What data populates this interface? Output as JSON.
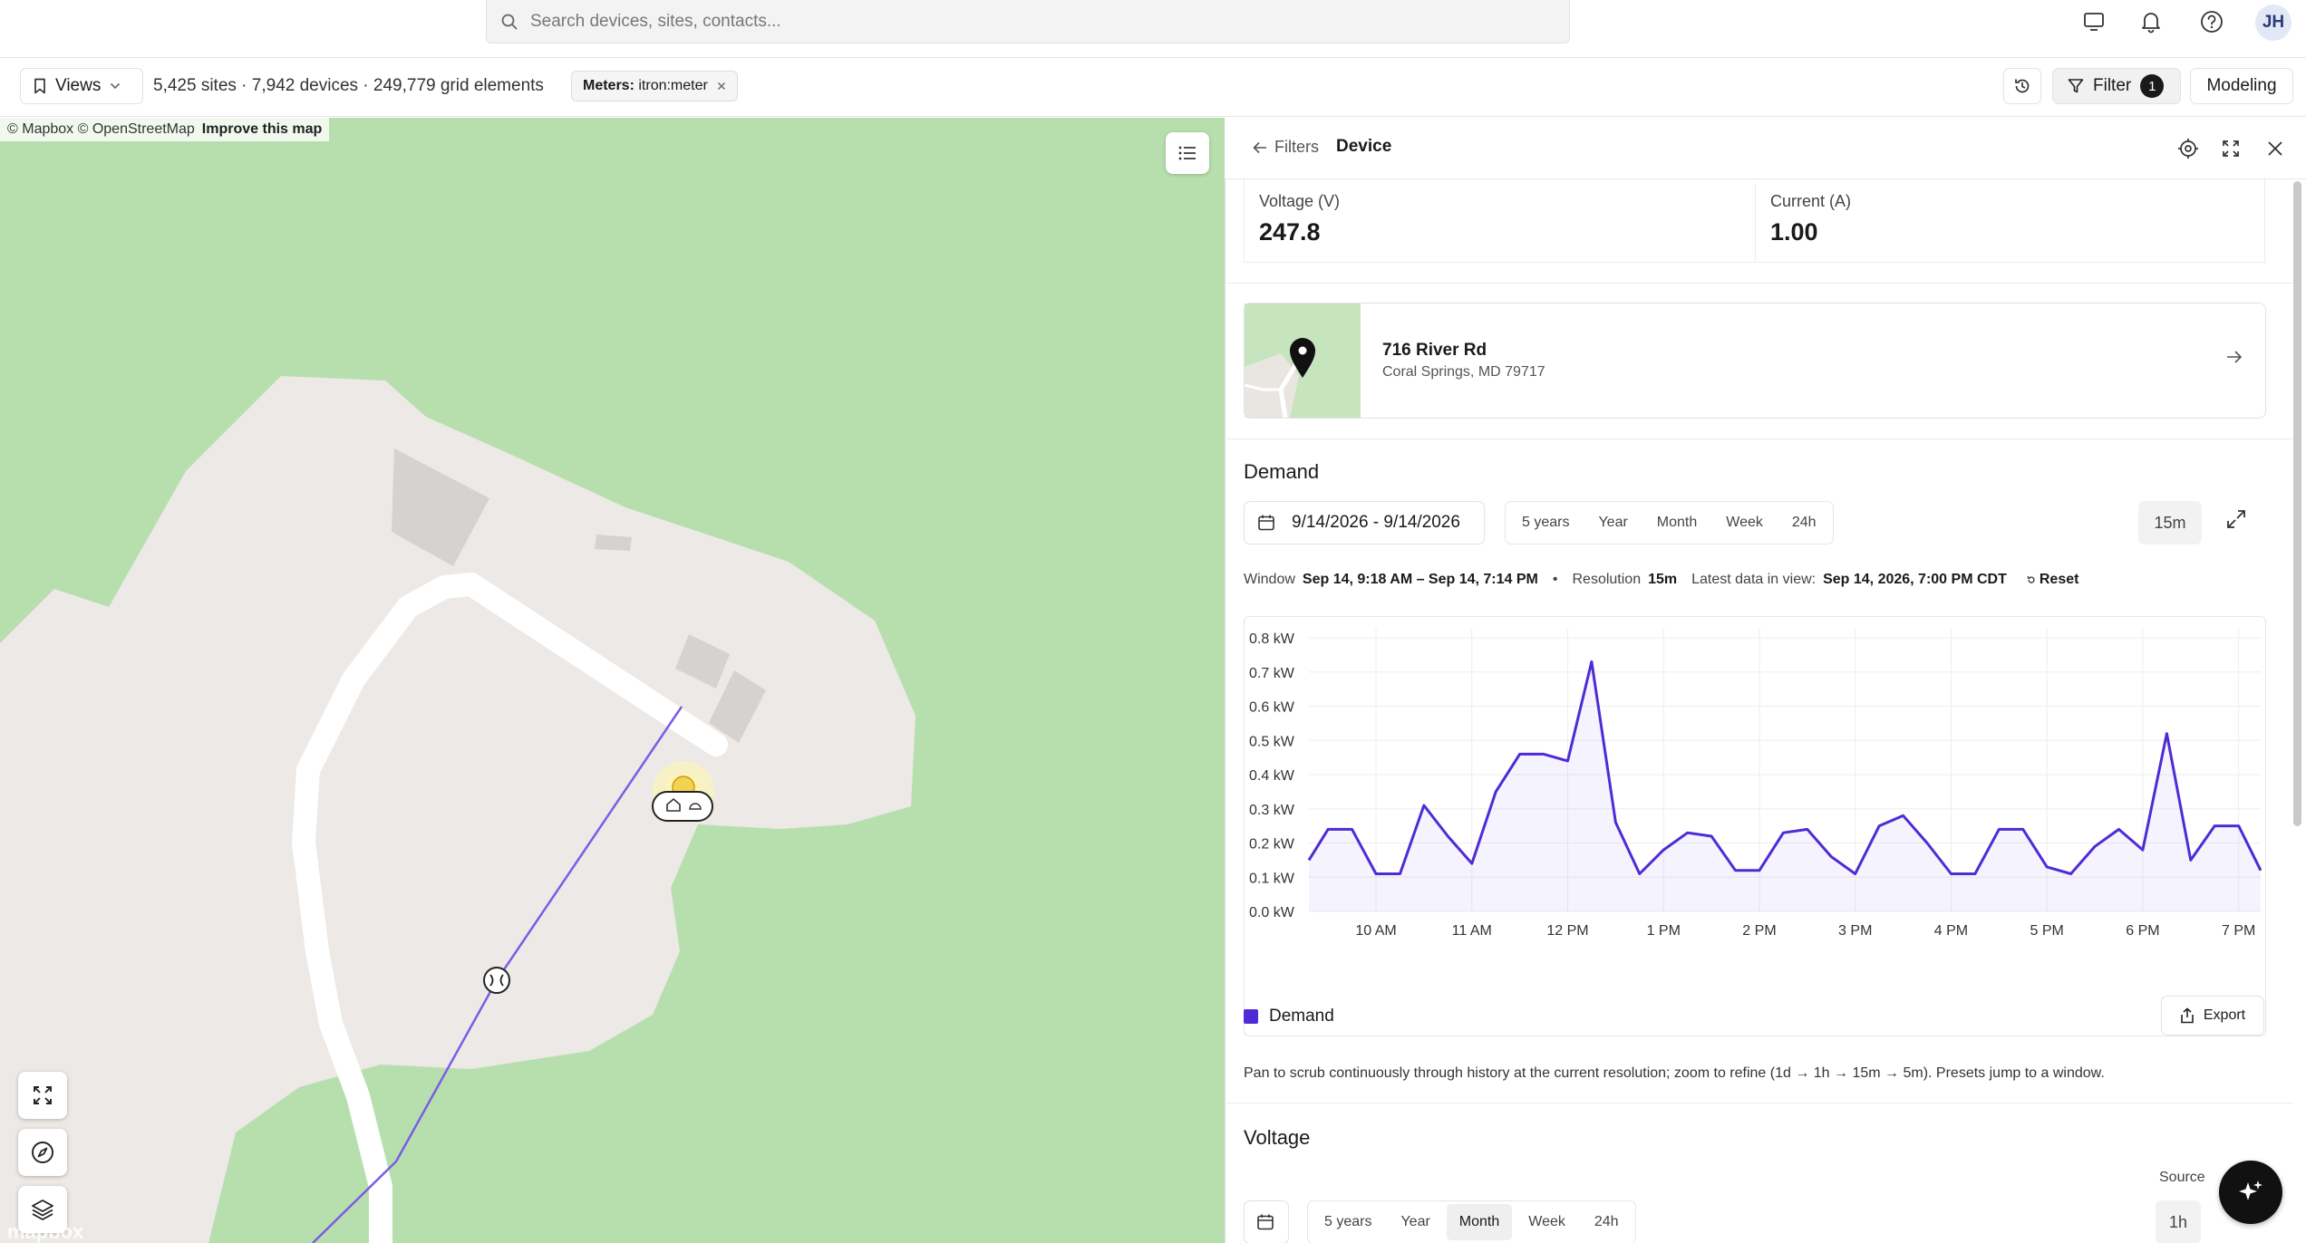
{
  "header": {
    "search_placeholder": "Search devices, sites, contacts...",
    "avatar_initials": "JH"
  },
  "toolbar": {
    "views_label": "Views",
    "stats": "5,425 sites · 7,942 devices · 249,779 grid elements",
    "filter_chip_key": "Meters:",
    "filter_chip_value": "itron:meter",
    "filter_label": "Filter",
    "filter_count": "1",
    "modeling_label": "Modeling"
  },
  "map": {
    "attribution": "© Mapbox © OpenStreetMap",
    "improve_link": "Improve this map",
    "logo_text": "mapbox",
    "colors": {
      "land": "#b7dfae",
      "parcel": "#ece9e6",
      "road": "#ffffff",
      "line": "#7b5ce6"
    }
  },
  "panel": {
    "back_label": "Filters",
    "title": "Device",
    "metrics": [
      {
        "label": "Voltage (V)",
        "value": "247.8"
      },
      {
        "label": "Current (A)",
        "value": "1.00"
      }
    ],
    "address": {
      "line1": "716 River Rd",
      "line2": "Coral Springs, MD 79717"
    },
    "demand": {
      "title": "Demand",
      "date_range": "9/14/2026 - 9/14/2026",
      "presets": [
        "5 years",
        "Year",
        "Month",
        "Week",
        "24h"
      ],
      "resolution_button": "15m",
      "window_label": "Window",
      "window_value": "Sep 14, 9:18 AM – Sep 14, 7:14 PM",
      "bullet": "•",
      "resolution_label": "Resolution",
      "resolution_value": "15m",
      "latest_label": "Latest data in view:",
      "latest_value": "Sep 14, 2026, 7:00 PM CDT",
      "reset_label": "Reset",
      "legend_label": "Demand",
      "export_label": "Export",
      "hint": "Pan to scrub continuously through history at the current resolution; zoom to refine (1d → 1h → 15m → 5m). Presets jump to a window."
    },
    "voltage": {
      "title": "Voltage",
      "source_label": "Source",
      "presets": [
        "5 years",
        "Year",
        "Month",
        "Week",
        "24h"
      ],
      "active_preset": "Month",
      "resolution_button": "1h"
    }
  },
  "chart_data": {
    "type": "area",
    "title": "",
    "xlabel": "",
    "ylabel": "",
    "y_unit": "kW",
    "ylim": [
      0,
      0.8
    ],
    "y_ticks": [
      "0.0 kW",
      "0.1 kW",
      "0.2 kW",
      "0.3 kW",
      "0.4 kW",
      "0.5 kW",
      "0.6 kW",
      "0.7 kW",
      "0.8 kW"
    ],
    "x_ticks": [
      "10 AM",
      "11 AM",
      "12 PM",
      "1 PM",
      "2 PM",
      "3 PM",
      "4 PM",
      "5 PM",
      "6 PM",
      "7 PM"
    ],
    "x_start_hours": 9.3,
    "x_end_hours": 19.23,
    "grid": true,
    "color": "#4f2bd6",
    "series": [
      {
        "name": "Demand",
        "x_hours": [
          9.3,
          9.5,
          9.75,
          10.0,
          10.25,
          10.5,
          10.75,
          11.0,
          11.25,
          11.5,
          11.75,
          12.0,
          12.25,
          12.5,
          12.75,
          13.0,
          13.25,
          13.5,
          13.75,
          14.0,
          14.25,
          14.5,
          14.75,
          15.0,
          15.25,
          15.5,
          15.75,
          16.0,
          16.25,
          16.5,
          16.75,
          17.0,
          17.25,
          17.5,
          17.75,
          18.0,
          18.25,
          18.5,
          18.75,
          19.0,
          19.23
        ],
        "values": [
          0.15,
          0.24,
          0.24,
          0.11,
          0.11,
          0.31,
          0.22,
          0.14,
          0.35,
          0.46,
          0.46,
          0.44,
          0.73,
          0.26,
          0.11,
          0.18,
          0.23,
          0.22,
          0.12,
          0.12,
          0.23,
          0.24,
          0.16,
          0.11,
          0.25,
          0.28,
          0.2,
          0.11,
          0.11,
          0.24,
          0.24,
          0.13,
          0.11,
          0.19,
          0.24,
          0.18,
          0.52,
          0.15,
          0.25,
          0.25,
          0.12
        ]
      }
    ]
  }
}
